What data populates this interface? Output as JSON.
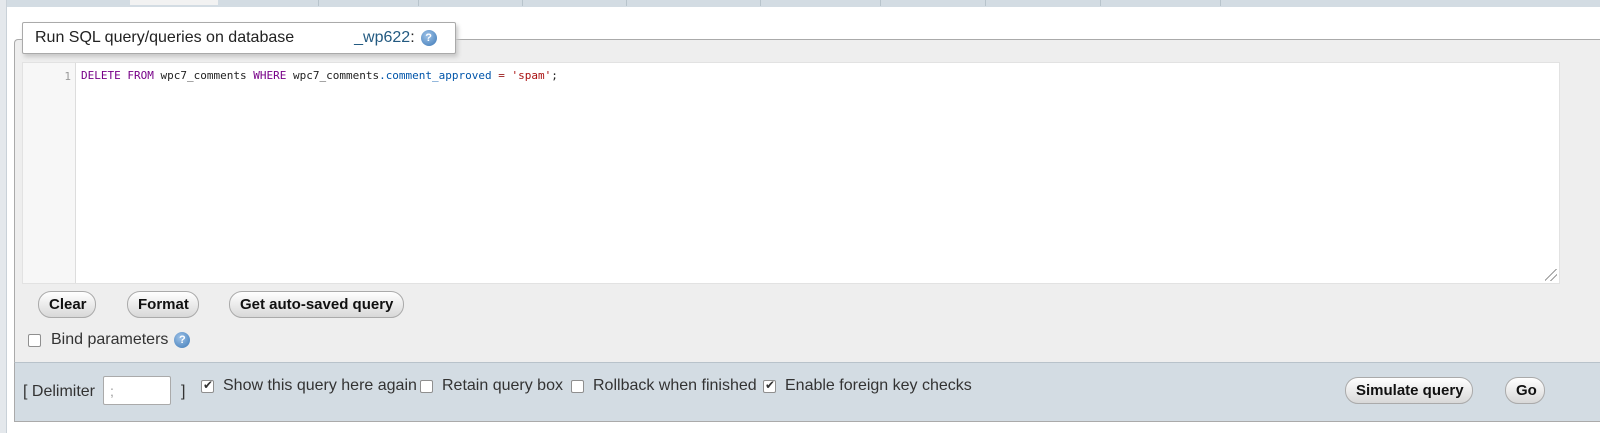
{
  "legend": {
    "title": "Run SQL query/queries on database",
    "db_name": "_wp622",
    "colon": ":",
    "help_glyph": "?"
  },
  "editor": {
    "line_number": "1",
    "tokens": {
      "kw_delete": "DELETE",
      "kw_from": "FROM",
      "table": "wpc7_comments",
      "kw_where": "WHERE",
      "qual": "wpc7_comments",
      "dot": ".",
      "column": "comment_approved",
      "op": "=",
      "value": "'spam'",
      "semicolon": ";"
    }
  },
  "buttons": {
    "clear": "Clear",
    "format": "Format",
    "auto_saved": "Get auto-saved query",
    "simulate": "Simulate query",
    "go": "Go"
  },
  "bind_parameters": {
    "label": "Bind parameters",
    "checked": false
  },
  "options": {
    "delimiter_open": "[ Delimiter",
    "delimiter_value": ";",
    "delimiter_close": "]",
    "show_query": {
      "label": "Show this query here again",
      "checked": true
    },
    "retain_box": {
      "label": "Retain query box",
      "checked": false
    },
    "rollback": {
      "label": "Rollback when finished",
      "checked": false
    },
    "foreign_keys": {
      "label": "Enable foreign key checks",
      "checked": true
    }
  },
  "icons": {
    "help": "help-icon",
    "resize": "resize-grip-icon",
    "check": "checkmark-icon"
  },
  "colors": {
    "db_link": "#235a81",
    "keyword": "#770088",
    "attribute": "#0055aa",
    "string": "#aa1111",
    "bottom_bar": "#d3dce3",
    "panel": "#eeeeee"
  }
}
